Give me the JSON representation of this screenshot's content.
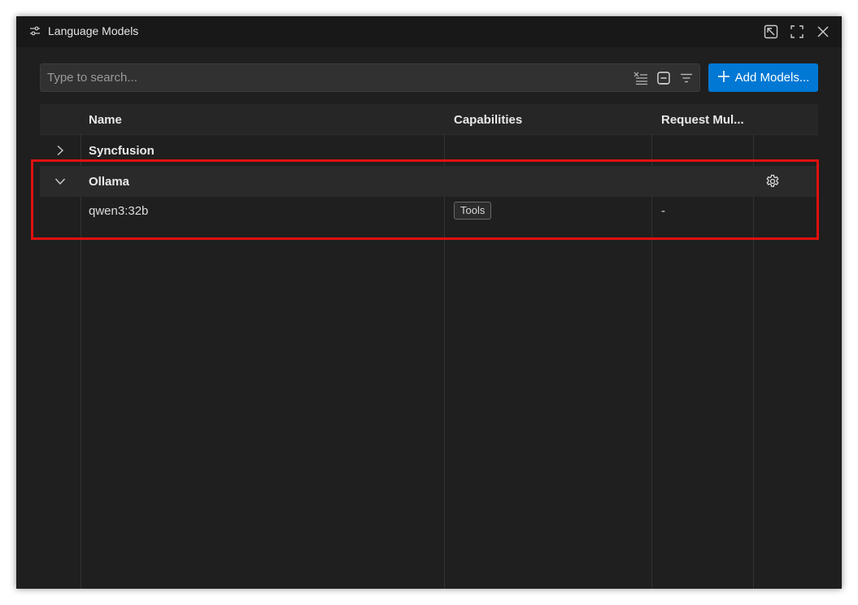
{
  "window": {
    "title": "Language Models",
    "icons": {
      "title": "settings-sliders-icon",
      "actions": [
        "open-in-editor-icon",
        "maximize-icon",
        "close-icon"
      ]
    }
  },
  "search": {
    "placeholder": "Type to search...",
    "value": "",
    "tools": [
      "clear-filter-icon",
      "collapse-all-icon",
      "filter-icon"
    ]
  },
  "add_button": {
    "label": "Add Models..."
  },
  "table": {
    "columns": [
      "Name",
      "Capabilities",
      "Request Mul..."
    ],
    "groups": [
      {
        "name": "Syncfusion",
        "expanded": false
      },
      {
        "name": "Ollama",
        "expanded": true,
        "models": [
          {
            "name": "qwen3:32b",
            "capability": "Tools",
            "request_multiplier": "-"
          }
        ]
      }
    ]
  },
  "colors": {
    "background": "#1f1f1f",
    "titlebar": "#181818",
    "accent": "#0078d4",
    "highlight": "#e01010"
  }
}
